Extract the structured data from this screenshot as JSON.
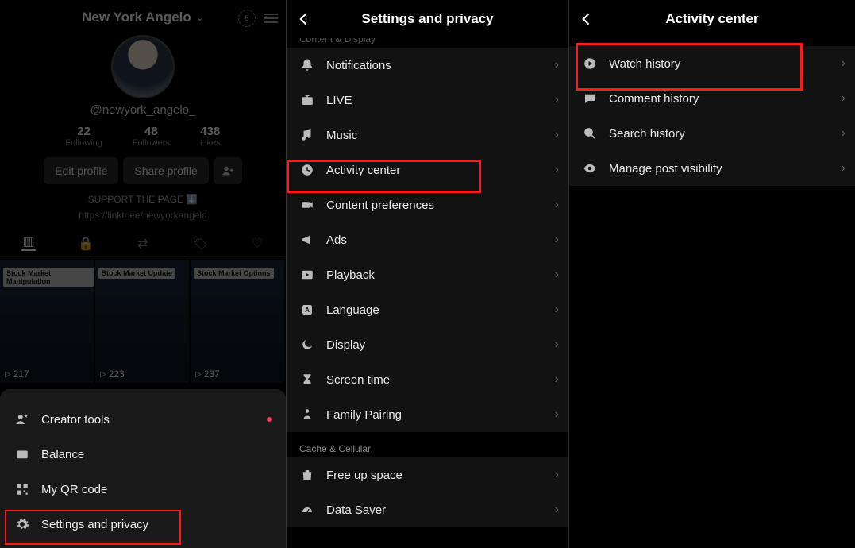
{
  "pane1": {
    "display_name": "New York Angelo",
    "coin_badge": "5",
    "handle": "@newyork_angelo_",
    "stats": [
      {
        "num": "22",
        "lbl": "Following"
      },
      {
        "num": "48",
        "lbl": "Followers"
      },
      {
        "num": "438",
        "lbl": "Likes"
      }
    ],
    "btn_edit": "Edit profile",
    "btn_share": "Share profile",
    "support": "SUPPORT THE PAGE ⬇️",
    "link": "https://linktr.ee/newyorkangelo",
    "videos": [
      {
        "tag": "Stock Market Manipulation",
        "views": "217"
      },
      {
        "tag": "Stock Market Update",
        "views": "223"
      },
      {
        "tag": "Stock Market Options",
        "views": "237"
      }
    ],
    "sheet": [
      {
        "icon": "person-star",
        "label": "Creator tools",
        "dot": true
      },
      {
        "icon": "wallet",
        "label": "Balance"
      },
      {
        "icon": "qr",
        "label": "My QR code"
      },
      {
        "icon": "gear",
        "label": "Settings and privacy"
      }
    ]
  },
  "pane2": {
    "title": "Settings and privacy",
    "header_cut": "Content & Display",
    "items": [
      {
        "icon": "bell",
        "label": "Notifications"
      },
      {
        "icon": "live",
        "label": "LIVE"
      },
      {
        "icon": "music",
        "label": "Music"
      },
      {
        "icon": "clock",
        "label": "Activity center",
        "highlight": true
      },
      {
        "icon": "camera",
        "label": "Content preferences"
      },
      {
        "icon": "megaphone",
        "label": "Ads"
      },
      {
        "icon": "play",
        "label": "Playback"
      },
      {
        "icon": "lang",
        "label": "Language"
      },
      {
        "icon": "moon",
        "label": "Display"
      },
      {
        "icon": "hourglass",
        "label": "Screen time"
      },
      {
        "icon": "family",
        "label": "Family Pairing"
      }
    ],
    "header2": "Cache & Cellular",
    "items2": [
      {
        "icon": "trash",
        "label": "Free up space"
      },
      {
        "icon": "gauge",
        "label": "Data Saver"
      }
    ]
  },
  "pane3": {
    "title": "Activity center",
    "items": [
      {
        "icon": "playcircle",
        "label": "Watch history",
        "highlight": true
      },
      {
        "icon": "comment",
        "label": "Comment history"
      },
      {
        "icon": "search",
        "label": "Search history"
      },
      {
        "icon": "eye",
        "label": "Manage post visibility"
      }
    ]
  }
}
